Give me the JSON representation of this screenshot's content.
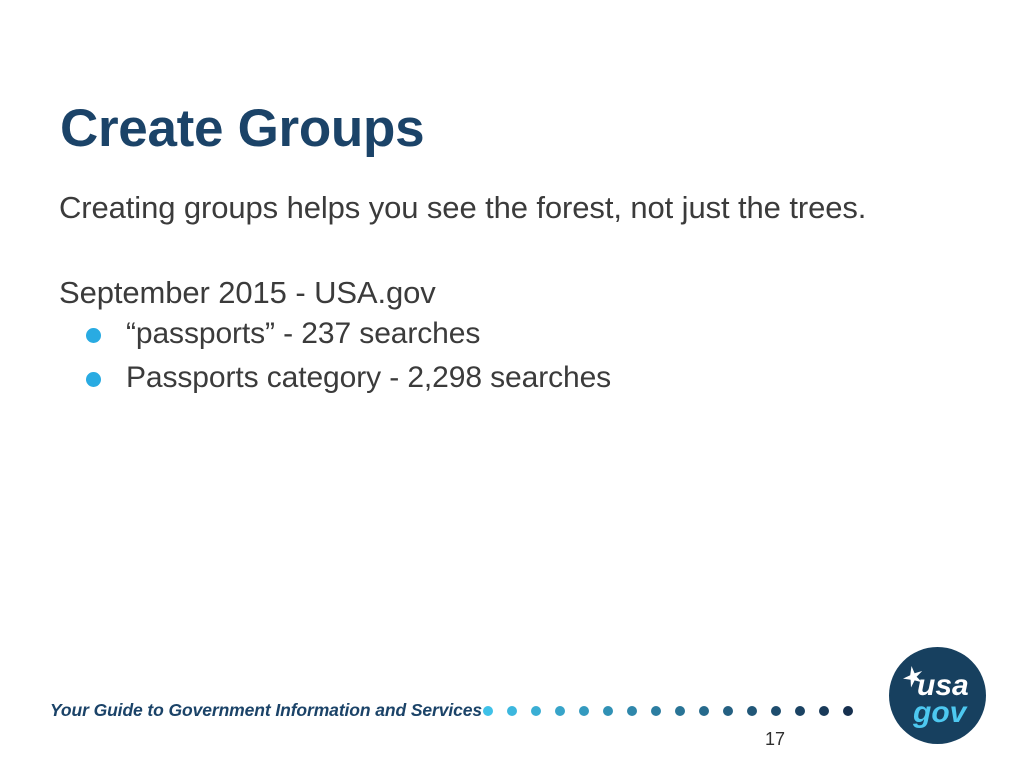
{
  "slide": {
    "title": "Create Groups",
    "page_number": "17",
    "background_color": "#ffffff",
    "title_color": "#1b4368",
    "body_text_color": "#3b3b3b",
    "bullet_color": "#29ABE2"
  },
  "body": {
    "lead_line": "Creating groups helps you see the forest, not just the trees.",
    "sub_heading": "September 2015 - USA.gov",
    "bullets": [
      {
        "text": "“passports” - 237 searches"
      },
      {
        "text": "Passports category - 2,298 searches"
      }
    ]
  },
  "footer": {
    "tagline": "Your Guide to Government Information and Services",
    "tagline_color": "#1b4368",
    "dot_rule": {
      "count": 16,
      "start_color": "#3FC1E8",
      "end_color": "#16304f",
      "spacing_px": 24
    }
  },
  "logo": {
    "name": "usa-gov-logo",
    "circle_color": "#17405f",
    "word_top": "usa",
    "word_top_color": "#ffffff",
    "word_bottom": "gov",
    "word_bottom_color": "#4DC8F0",
    "star": "star-icon"
  }
}
